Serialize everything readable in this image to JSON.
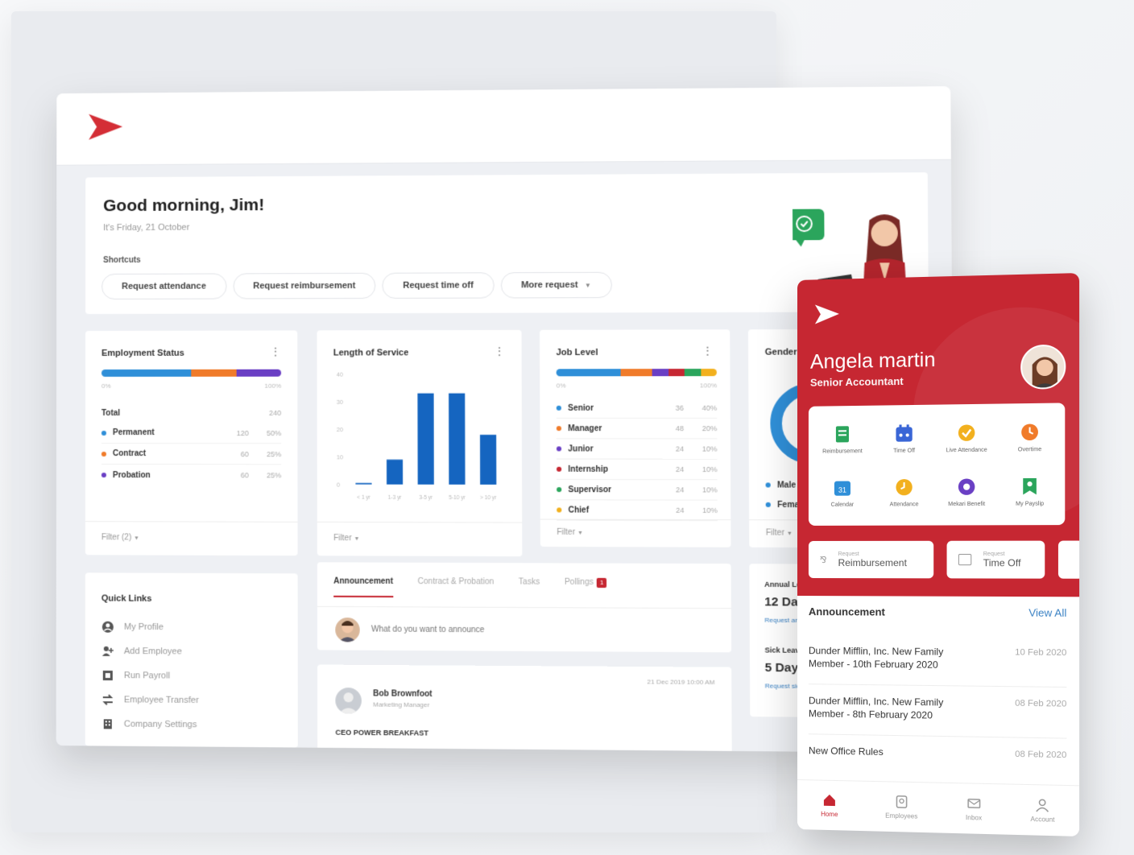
{
  "desktop": {
    "greeting": "Good morning, Jim!",
    "date": "It's Friday, 21 October",
    "shortcuts_label": "Shortcuts",
    "shortcuts": [
      "Request attendance",
      "Request reimbursement",
      "Request time off",
      "More request"
    ],
    "employment_status": {
      "title": "Employment Status",
      "range_min": "0%",
      "range_max": "100%",
      "total_label": "Total",
      "total_value": "240",
      "rows": [
        {
          "label": "Permanent",
          "count": "120",
          "pct": "50%",
          "color": "#2f8fd8"
        },
        {
          "label": "Contract",
          "count": "60",
          "pct": "25%",
          "color": "#f07b2a"
        },
        {
          "label": "Probation",
          "count": "60",
          "pct": "25%",
          "color": "#6a3fc4"
        }
      ],
      "filter": "Filter (2)"
    },
    "length_of_service": {
      "title": "Length of Service",
      "filter": "Filter"
    },
    "job_level": {
      "title": "Job Level",
      "range_min": "0%",
      "range_max": "100%",
      "rows": [
        {
          "label": "Senior",
          "count": "36",
          "pct": "40%",
          "color": "#2f8fd8"
        },
        {
          "label": "Manager",
          "count": "48",
          "pct": "20%",
          "color": "#f07b2a"
        },
        {
          "label": "Junior",
          "count": "24",
          "pct": "10%",
          "color": "#6a3fc4"
        },
        {
          "label": "Internship",
          "count": "24",
          "pct": "10%",
          "color": "#c62732"
        },
        {
          "label": "Supervisor",
          "count": "24",
          "pct": "10%",
          "color": "#2ba55c"
        },
        {
          "label": "Chief",
          "count": "24",
          "pct": "10%",
          "color": "#f2b01e"
        }
      ],
      "filter": "Filter"
    },
    "gender": {
      "title": "Gender Diversity",
      "rows": [
        {
          "label": "Male",
          "color": "#2f8fd8"
        },
        {
          "label": "Female",
          "color": "#2f8fd8"
        }
      ],
      "filter": "Filter"
    },
    "quick_links": {
      "title": "Quick Links",
      "items": [
        "My Profile",
        "Add Employee",
        "Run Payroll",
        "Employee Transfer",
        "Company Settings"
      ]
    },
    "feed": {
      "tabs": [
        "Announcement",
        "Contract & Probation",
        "Tasks",
        "Pollings"
      ],
      "polling_badge": "1",
      "placeholder": "What do you want to announce",
      "post_author": "Bob Brownfoot",
      "post_role": "Marketing Manager",
      "post_time": "21 Dec 2019 10:00 AM",
      "post_title": "CEO POWER BREAKFAST"
    },
    "leave": {
      "annual_label": "Annual Leave",
      "annual_value": "12 Days",
      "annual_link": "Request annual leave",
      "sick_label": "Sick Leave",
      "sick_value": "5 Days",
      "sick_link": "Request sick leave"
    }
  },
  "chart_data": {
    "type": "bar",
    "title": "Length of Service",
    "categories": [
      "< 1 yr",
      "1-3 yr",
      "3-5 yr",
      "5-10 yr",
      "> 10 yr"
    ],
    "values": [
      0.5,
      9,
      33,
      33,
      18
    ],
    "yticks": [
      "40",
      "30",
      "20",
      "10",
      "0"
    ],
    "ylim": [
      0,
      40
    ],
    "color": "#1565c0"
  },
  "mobile": {
    "name": "Angela martin",
    "role": "Senior Accountant",
    "apps": [
      {
        "label": "Reimbursement",
        "icon": "receipt-icon",
        "color": "#2ba55c"
      },
      {
        "label": "Time Off",
        "icon": "calendar-off-icon",
        "color": "#3a66d6"
      },
      {
        "label": "Live Attendance",
        "icon": "badge-check-icon",
        "color": "#f2b01e"
      },
      {
        "label": "Overtime",
        "icon": "clock-icon",
        "color": "#f07b2a"
      },
      {
        "label": "Calendar",
        "icon": "calendar-icon",
        "color": "#2f8fd8"
      },
      {
        "label": "Attendance",
        "icon": "attendance-clock-icon",
        "color": "#f2b01e"
      },
      {
        "label": "Mekari Benefit",
        "icon": "benefit-icon",
        "color": "#6a3fc4"
      },
      {
        "label": "My Payslip",
        "icon": "payslip-icon",
        "color": "#2ba55c"
      }
    ],
    "requests": [
      {
        "small": "Request",
        "big": "Reimbursement"
      },
      {
        "small": "Request",
        "big": "Time Off"
      }
    ],
    "announcement_title": "Announcement",
    "view_all": "View All",
    "announcements": [
      {
        "title": "Dunder Mifflin, Inc. New Family Member - 10th February 2020",
        "date": "10 Feb 2020"
      },
      {
        "title": "Dunder Mifflin, Inc. New Family Member - 8th February 2020",
        "date": "08 Feb 2020"
      },
      {
        "title": "New Office Rules",
        "date": "08 Feb 2020"
      }
    ],
    "nav": [
      "Home",
      "Employees",
      "Inbox",
      "Account"
    ]
  }
}
